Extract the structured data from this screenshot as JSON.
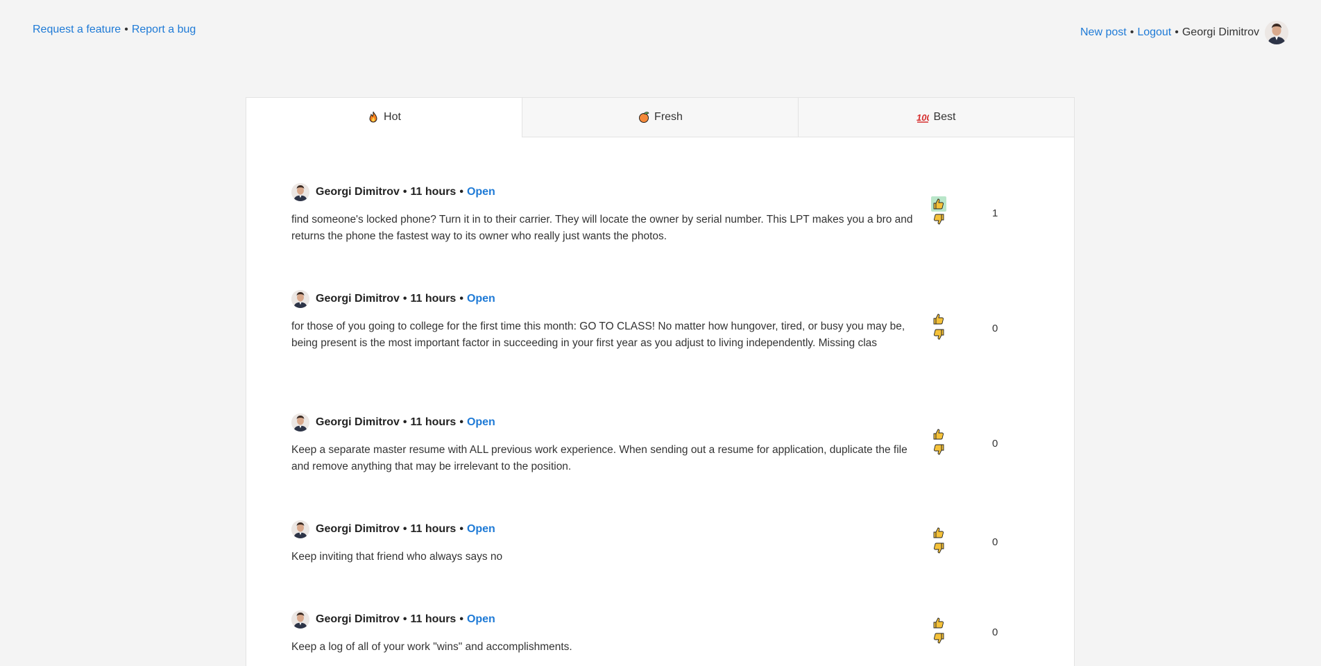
{
  "header": {
    "request_feature": "Request a feature",
    "report_bug": "Report a bug",
    "new_post": "New post",
    "logout": "Logout",
    "user_name": "Georgi Dimitrov",
    "separator": "•"
  },
  "tabs": [
    {
      "label": "Hot",
      "icon": "fire-icon",
      "active": true
    },
    {
      "label": "Fresh",
      "icon": "peach-icon",
      "active": false
    },
    {
      "label": "Best",
      "icon": "hundred-points-icon",
      "active": false
    }
  ],
  "posts": [
    {
      "author": "Georgi Dimitrov",
      "time": "11 hours",
      "status": "Open",
      "body": "find someone's locked phone? Turn it in to their carrier. They will locate the owner by serial number. This LPT makes you a bro and returns the phone the fastest way to its owner who really just wants the photos.",
      "score": "1",
      "upvoted": true
    },
    {
      "author": "Georgi Dimitrov",
      "time": "11 hours",
      "status": "Open",
      "body": "for those of you going to college for the first time this month: GO TO CLASS! No matter how hungover, tired, or busy you may be, being present is the most important factor in succeeding in your first year as you adjust to living independently. Missing clas",
      "score": "0",
      "upvoted": false
    },
    {
      "author": "Georgi Dimitrov",
      "time": "11 hours",
      "status": "Open",
      "body": "Keep a separate master resume with ALL previous work experience. When sending out a resume for application, duplicate the file and remove anything that may be irrelevant to the position.",
      "score": "0",
      "upvoted": false
    },
    {
      "author": "Georgi Dimitrov",
      "time": "11 hours",
      "status": "Open",
      "body": "Keep inviting that friend who always says no",
      "score": "0",
      "upvoted": false
    },
    {
      "author": "Georgi Dimitrov",
      "time": "11 hours",
      "status": "Open",
      "body": "Keep a log of all of your work \"wins\" and accomplishments.",
      "score": "0",
      "upvoted": false
    }
  ]
}
